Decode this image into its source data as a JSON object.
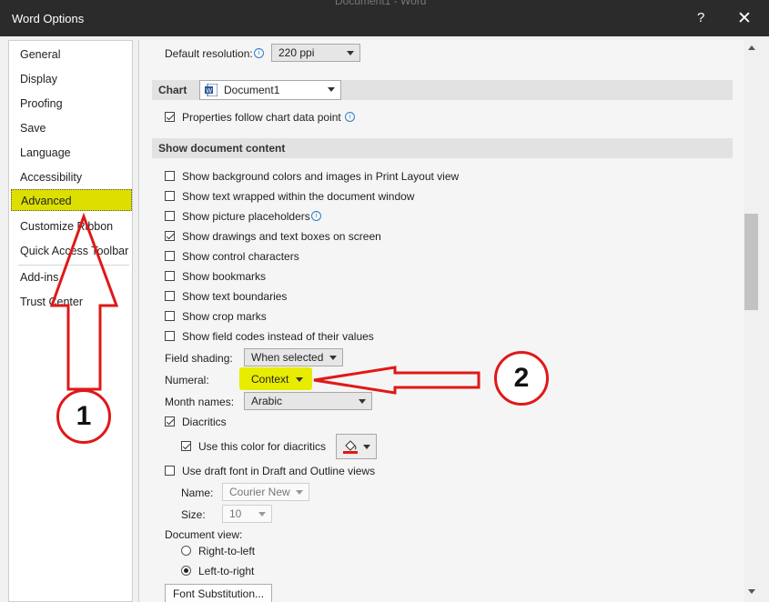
{
  "window": {
    "title": "Word Options",
    "background_title": "Document1 - Word",
    "help_label": "?",
    "close_label": "✕"
  },
  "sidebar": {
    "items": [
      {
        "label": "General"
      },
      {
        "label": "Display"
      },
      {
        "label": "Proofing"
      },
      {
        "label": "Save"
      },
      {
        "label": "Language"
      },
      {
        "label": "Accessibility"
      },
      {
        "label": "Advanced",
        "selected": true
      },
      {
        "label": "Customize Ribbon"
      },
      {
        "label": "Quick Access Toolbar"
      },
      {
        "label": "Add-ins"
      },
      {
        "label": "Trust Center"
      }
    ]
  },
  "content": {
    "default_resolution": {
      "label": "Default resolution:",
      "value": "220 ppi"
    },
    "chart_section": {
      "title": "Chart",
      "document": "Document1",
      "properties_follow": "Properties follow chart data point",
      "properties_checked": true
    },
    "show_content_section": {
      "title": "Show document content"
    },
    "options": [
      {
        "label": "Show background colors and images in Print Layout view",
        "checked": false
      },
      {
        "label": "Show text wrapped within the document window",
        "checked": false
      },
      {
        "label": "Show picture placeholders",
        "checked": false
      },
      {
        "label": "Show drawings and text boxes on screen",
        "checked": true
      },
      {
        "label": "Show control characters",
        "checked": false
      },
      {
        "label": "Show bookmarks",
        "checked": false
      },
      {
        "label": "Show text boundaries",
        "checked": false
      },
      {
        "label": "Show crop marks",
        "checked": false
      },
      {
        "label": "Show field codes instead of their values",
        "checked": false
      }
    ],
    "field_shading": {
      "label": "Field shading:",
      "value": "When selected"
    },
    "numeral": {
      "label": "Numeral:",
      "value": "Context"
    },
    "month_names": {
      "label": "Month names:",
      "value": "Arabic"
    },
    "diacritics": {
      "label": "Diacritics",
      "checked": true
    },
    "diacritics_color": {
      "label": "Use this color for diacritics",
      "checked": true,
      "swatch_color": "#e01818"
    },
    "draft_font": {
      "label": "Use draft font in Draft and Outline views",
      "checked": false
    },
    "draft_name": {
      "label": "Name:",
      "value": "Courier New"
    },
    "draft_size": {
      "label": "Size:",
      "value": "10"
    },
    "document_view": {
      "label": "Document view:",
      "rtl": "Right-to-left",
      "ltr": "Left-to-right",
      "selected": "ltr"
    },
    "font_substitution_button": "Font Substitution..."
  },
  "annotations": {
    "marker_1": "1",
    "marker_2": "2",
    "color": "#e01818",
    "highlight_color": "#e7ec00"
  }
}
